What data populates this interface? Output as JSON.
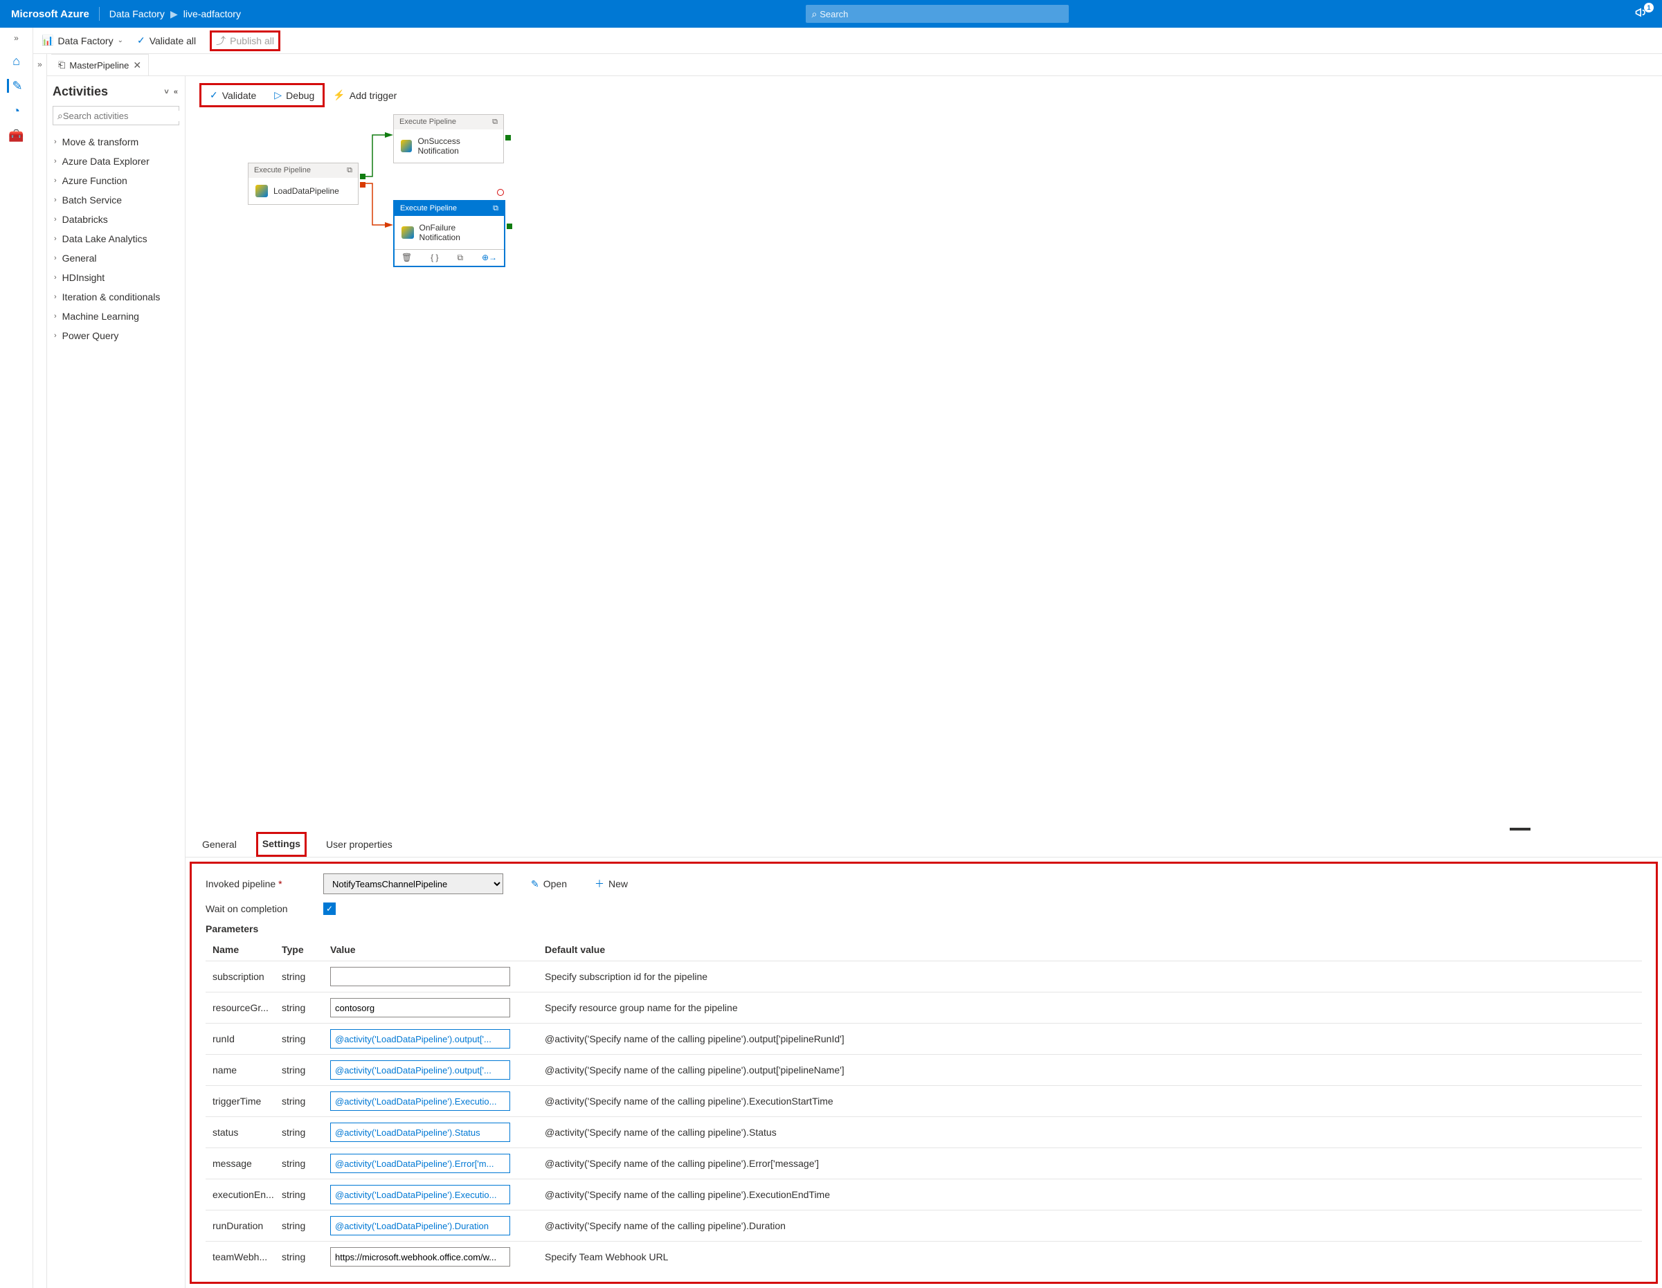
{
  "topbar": {
    "brand": "Microsoft Azure",
    "breadcrumb": [
      "Data Factory",
      "live-adfactory"
    ],
    "search_placeholder": "Search",
    "notif_count": "1"
  },
  "toolbar1": {
    "factory_label": "Data Factory",
    "validate_all": "Validate all",
    "publish_all": "Publish all"
  },
  "tab": {
    "title": "MasterPipeline"
  },
  "activities": {
    "title": "Activities",
    "search_placeholder": "Search activities",
    "categories": [
      "Move & transform",
      "Azure Data Explorer",
      "Azure Function",
      "Batch Service",
      "Databricks",
      "Data Lake Analytics",
      "General",
      "HDInsight",
      "Iteration & conditionals",
      "Machine Learning",
      "Power Query"
    ]
  },
  "canvas_toolbar": {
    "validate": "Validate",
    "debug": "Debug",
    "trigger": "Add trigger"
  },
  "nodes": {
    "n1": {
      "type": "Execute Pipeline",
      "label": "LoadDataPipeline"
    },
    "n2": {
      "type": "Execute Pipeline",
      "label": "OnSuccess Notification"
    },
    "n3": {
      "type": "Execute Pipeline",
      "label": "OnFailure Notification"
    }
  },
  "panel_tabs": {
    "general": "General",
    "settings": "Settings",
    "user": "User properties"
  },
  "settings": {
    "invoked_label": "Invoked pipeline",
    "invoked_value": "NotifyTeamsChannelPipeline",
    "open": "Open",
    "new": "New",
    "wait_label": "Wait on completion",
    "params_label": "Parameters",
    "headers": {
      "name": "Name",
      "type": "Type",
      "value": "Value",
      "default": "Default value"
    },
    "params": [
      {
        "name": "subscription",
        "type": "string",
        "value": "",
        "default": "Specify subscription id for the pipeline",
        "expr": false
      },
      {
        "name": "resourceGr...",
        "type": "string",
        "value": "contosorg",
        "default": "Specify resource group name for the pipeline",
        "expr": false
      },
      {
        "name": "runId",
        "type": "string",
        "value": "@activity('LoadDataPipeline').output['...",
        "default": "@activity('Specify name of the calling pipeline').output['pipelineRunId']",
        "expr": true
      },
      {
        "name": "name",
        "type": "string",
        "value": "@activity('LoadDataPipeline').output['...",
        "default": "@activity('Specify name of the calling pipeline').output['pipelineName']",
        "expr": true
      },
      {
        "name": "triggerTime",
        "type": "string",
        "value": "@activity('LoadDataPipeline').Executio...",
        "default": "@activity('Specify name of the calling pipeline').ExecutionStartTime",
        "expr": true
      },
      {
        "name": "status",
        "type": "string",
        "value": "@activity('LoadDataPipeline').Status",
        "default": "@activity('Specify name of the calling pipeline').Status",
        "expr": true
      },
      {
        "name": "message",
        "type": "string",
        "value": "@activity('LoadDataPipeline').Error['m...",
        "default": "@activity('Specify name of the calling pipeline').Error['message']",
        "expr": true
      },
      {
        "name": "executionEn...",
        "type": "string",
        "value": "@activity('LoadDataPipeline').Executio...",
        "default": "@activity('Specify name of the calling pipeline').ExecutionEndTime",
        "expr": true
      },
      {
        "name": "runDuration",
        "type": "string",
        "value": "@activity('LoadDataPipeline').Duration",
        "default": "@activity('Specify name of the calling pipeline').Duration",
        "expr": true
      },
      {
        "name": "teamWebh...",
        "type": "string",
        "value": "https://microsoft.webhook.office.com/w...",
        "default": "Specify Team Webhook URL",
        "expr": false
      }
    ]
  }
}
